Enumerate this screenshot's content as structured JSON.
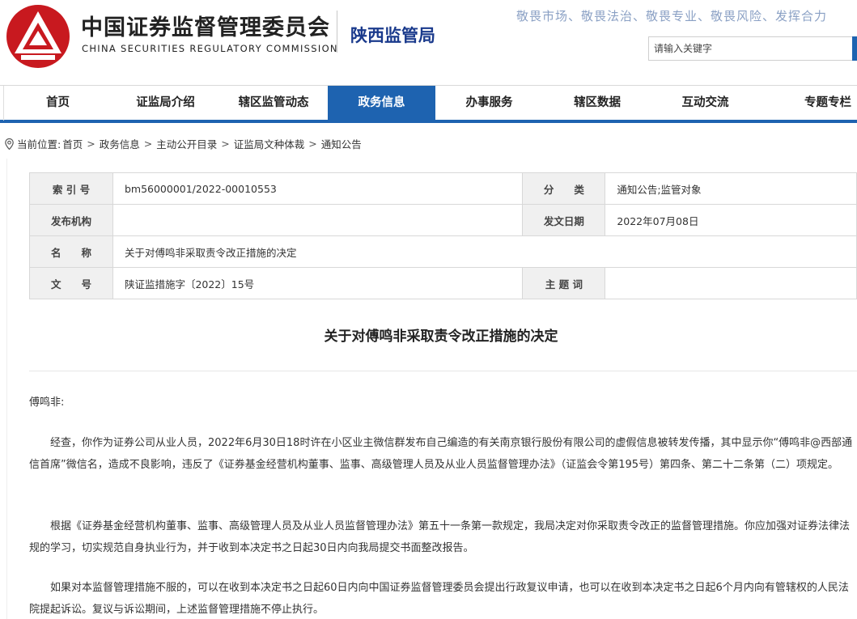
{
  "header": {
    "org_cn": "中国证券监督管理委员会",
    "org_en": "CHINA SECURITIES REGULATORY COMMISSION",
    "bureau": "陕西监管局",
    "slogan": "敬畏市场、敬畏法治、敬畏专业、敬畏风险、发挥合力",
    "search_placeholder": "请输入关键字",
    "logo_icon": "csrc-logo-icon",
    "colors": {
      "brand_red": "#c8191f",
      "brand_blue": "#1e63b0"
    }
  },
  "nav": {
    "items": [
      {
        "label": "首页"
      },
      {
        "label": "证监局介绍"
      },
      {
        "label": "辖区监管动态"
      },
      {
        "label": "政务信息",
        "active": true
      },
      {
        "label": "办事服务"
      },
      {
        "label": "辖区数据"
      },
      {
        "label": "互动交流"
      },
      {
        "label": "专题专栏"
      }
    ]
  },
  "breadcrumb": {
    "prefix": "当前位置:",
    "icon": "location-pin-icon",
    "items": [
      "首页",
      "政务信息",
      "主动公开目录",
      "证监局文种体裁",
      "通知公告"
    ],
    "separator": ">"
  },
  "meta": {
    "index_label": "索 引 号",
    "index_value": "bm56000001/2022-00010553",
    "category_label": "分　　类",
    "category_value": "通知公告;监管对象",
    "publisher_label": "发布机构",
    "publisher_value": "",
    "date_label": "发文日期",
    "date_value": "2022年07月08日",
    "name_label": "名　　称",
    "name_value": "关于对傅鸣非采取责令改正措施的决定",
    "docno_label": "文　　号",
    "docno_value": "陕证监措施字〔2022〕15号",
    "keywords_label": "主 题 词",
    "keywords_value": ""
  },
  "document": {
    "title": "关于对傅鸣非采取责令改正措施的决定",
    "addressee": "傅鸣非:",
    "paragraphs": [
      "经查，你作为证券公司从业人员，2022年6月30日18时许在小区业主微信群发布自己编造的有关南京银行股份有限公司的虚假信息被转发传播，其中显示你“傅鸣非@西部通信首席”微信名，造成不良影响，违反了《证券基金经营机构董事、监事、高级管理人员及从业人员监督管理办法》（证监会令第195号）第四条、第二十二条第（二）项规定。",
      "根据《证券基金经营机构董事、监事、高级管理人员及从业人员监督管理办法》第五十一条第一款规定，我局决定对你采取责令改正的监督管理措施。你应加强对证券法律法规的学习，切实规范自身执业行为，并于收到本决定书之日起30日内向我局提交书面整改报告。",
      "如果对本监督管理措施不服的，可以在收到本决定书之日起60日内向中国证券监督管理委员会提出行政复议申请，也可以在收到本决定书之日起6个月内向有管辖权的人民法院提起诉讼。复议与诉讼期间，上述监督管理措施不停止执行。"
    ]
  }
}
